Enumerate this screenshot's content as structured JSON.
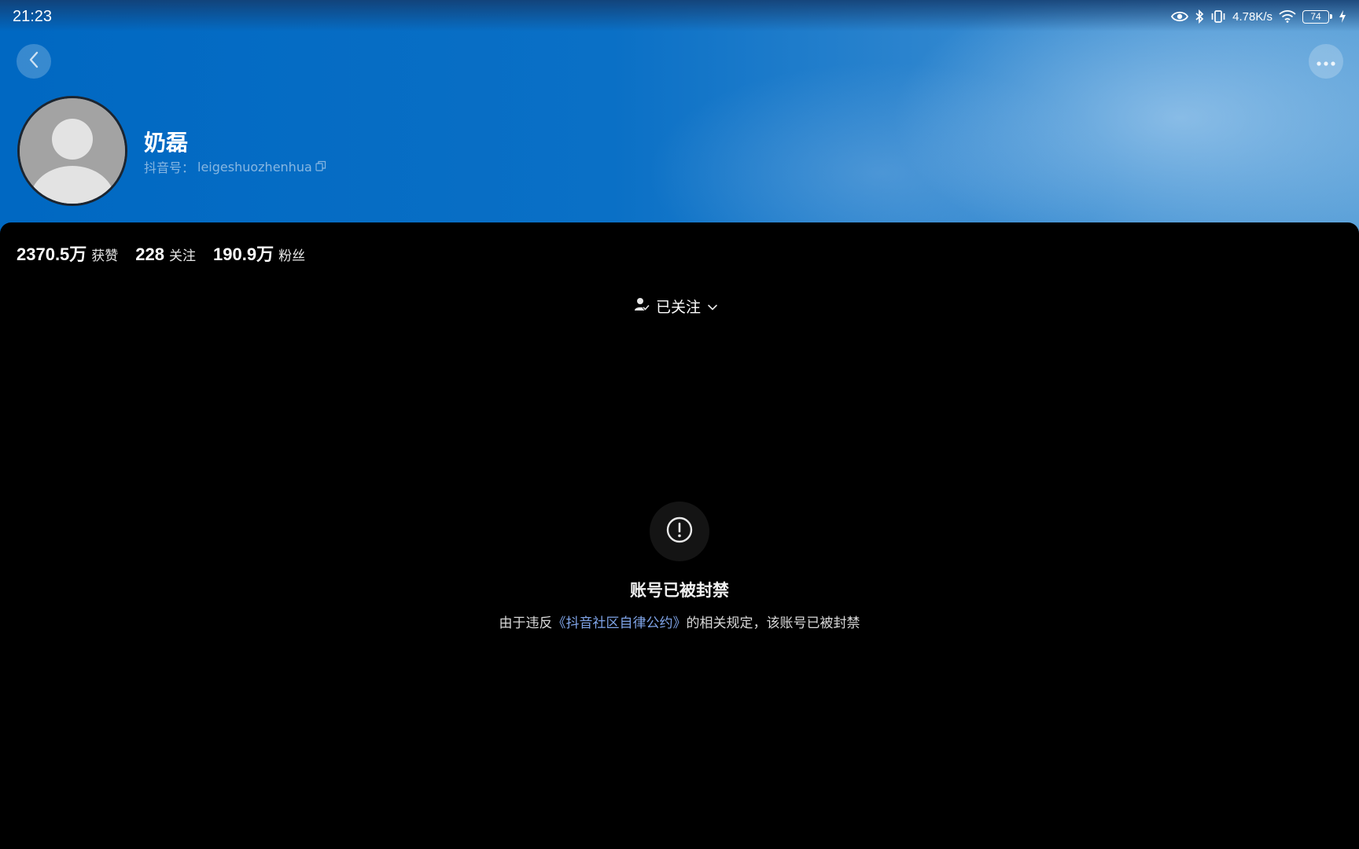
{
  "status_bar": {
    "time": "21:23",
    "network_speed": "4.78K/s",
    "battery_level": "74",
    "icons": [
      "eye-icon",
      "bluetooth-icon",
      "vibrate-icon",
      "wifi-icon",
      "battery-icon",
      "charging-icon"
    ]
  },
  "header": {
    "back_icon": "chevron-left-icon",
    "more_icon": "ellipsis-icon"
  },
  "profile": {
    "name": "奶磊",
    "id_label": "抖音号：",
    "id_value": "leigeshuozhenhua",
    "copy_icon": "copy-icon"
  },
  "stats": [
    {
      "value": "2370.5万",
      "label": "获赞"
    },
    {
      "value": "228",
      "label": "关注"
    },
    {
      "value": "190.9万",
      "label": "粉丝"
    }
  ],
  "follow": {
    "label": "已关注",
    "icon": "user-check-icon",
    "dropdown_icon": "chevron-down-icon"
  },
  "ban_notice": {
    "icon": "exclamation-circle-icon",
    "title": "账号已被封禁",
    "desc_prefix": "由于违反",
    "desc_link": "《抖音社区自律公约》",
    "desc_suffix": "的相关规定，该账号已被封禁"
  },
  "colors": {
    "header_blue": "#0068c2",
    "link_blue": "#7fa4e8",
    "background": "#000000"
  }
}
